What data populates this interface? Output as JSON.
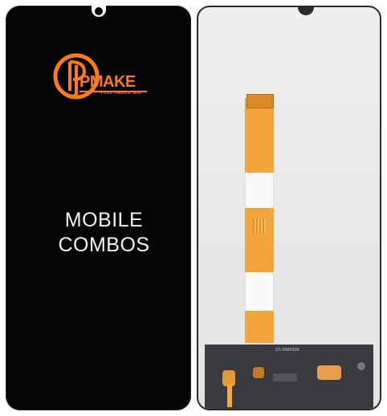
{
  "front": {
    "brand": "PMAKE",
    "tagline": "YOUR CHOICE WIN",
    "caption_line1": "MOBILE",
    "caption_line2": "COMBOS"
  },
  "back": {
    "board_label": "6053889 V2"
  },
  "colors": {
    "brand_orange": "#ff7a1a",
    "flex_orange": "#f2a53a",
    "panel_black": "#050505",
    "back_gray": "#e8e8e8"
  }
}
